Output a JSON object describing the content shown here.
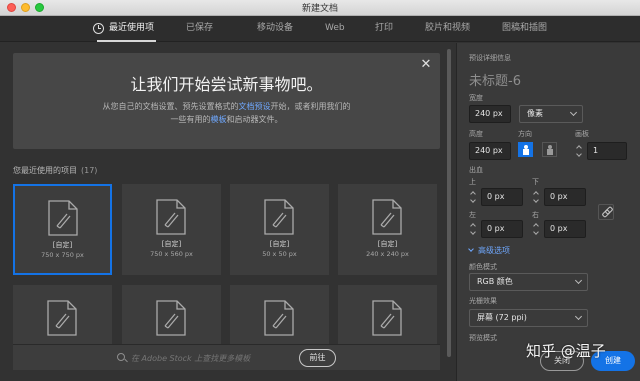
{
  "window": {
    "title": "新建文档"
  },
  "tabs": [
    {
      "label": "最近使用项",
      "active": true
    },
    {
      "label": "已保存"
    },
    {
      "label": "移动设备"
    },
    {
      "label": "Web"
    },
    {
      "label": "打印"
    },
    {
      "label": "胶片和视频"
    },
    {
      "label": "图稿和插图"
    }
  ],
  "hero": {
    "title": "让我们开始尝试新事物吧。",
    "line1_pre": "从您自己的文档设置、预先设置格式的",
    "line1_link": "文档预设",
    "line1_post": "开始，或者利用我们的",
    "line2_pre": "一些有用的",
    "line2_link": "模板",
    "line2_post": "和启动器文件。"
  },
  "recent": {
    "title": "您最近使用的项目",
    "count": "(17)",
    "items": [
      {
        "name": "[自定]",
        "size": "750 x 750 px",
        "selected": true
      },
      {
        "name": "[自定]",
        "size": "750 x 560 px"
      },
      {
        "name": "[自定]",
        "size": "50 x 50 px"
      },
      {
        "name": "[自定]",
        "size": "240 x 240 px"
      },
      {
        "name": "",
        "size": ""
      },
      {
        "name": "",
        "size": ""
      },
      {
        "name": "",
        "size": ""
      },
      {
        "name": "",
        "size": ""
      }
    ]
  },
  "search": {
    "placeholder": "在 Adobe Stock 上查找更多模板",
    "go_label": "前往"
  },
  "details": {
    "section_label": "预设详细信息",
    "doc_name": "未标题-6",
    "width_label": "宽度",
    "width_value": "240 px",
    "unit": "像素",
    "height_label": "高度",
    "height_value": "240 px",
    "orientation_label": "方向",
    "artboards_label": "画板",
    "artboards_value": "1",
    "bleed_label": "出血",
    "top_label": "上",
    "top_value": "0 px",
    "bottom_label": "下",
    "bottom_value": "0 px",
    "left_label": "左",
    "left_value": "0 px",
    "right_label": "右",
    "right_value": "0 px",
    "advanced_label": "高级选项",
    "color_mode_label": "颜色模式",
    "color_mode_value": "RGB 颜色",
    "raster_label": "光栅效果",
    "raster_value": "屏幕 (72 ppi)",
    "preview_label": "预览模式"
  },
  "buttons": {
    "close_label": "关闭",
    "create_label": "创建"
  },
  "watermark": "知乎 @温子",
  "colors": {
    "accent": "#1473e6",
    "link": "#6fa8ff",
    "panel": "#3a3a3a",
    "background": "#323232"
  }
}
